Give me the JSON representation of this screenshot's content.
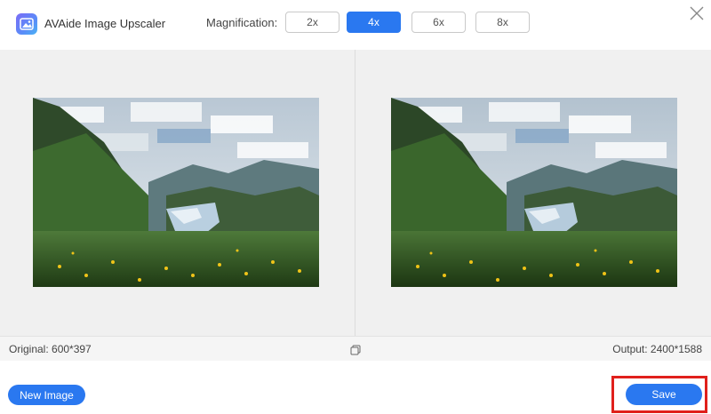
{
  "header": {
    "app_title": "AVAide Image Upscaler",
    "logo_icon": "image-icon",
    "magnification_label": "Magnification:",
    "magnification_options": [
      "2x",
      "4x",
      "6x",
      "8x"
    ],
    "selected_magnification": "4x",
    "close_icon": "close-icon"
  },
  "info": {
    "original": "Original: 600*397",
    "output": "Output: 2400*1588",
    "compare_icon": "copy-icon"
  },
  "footer": {
    "new_image_label": "New Image",
    "save_label": "Save"
  },
  "colors": {
    "accent": "#2a78f0",
    "highlight": "#e0201c",
    "preview_bg": "#f0f0f0"
  }
}
